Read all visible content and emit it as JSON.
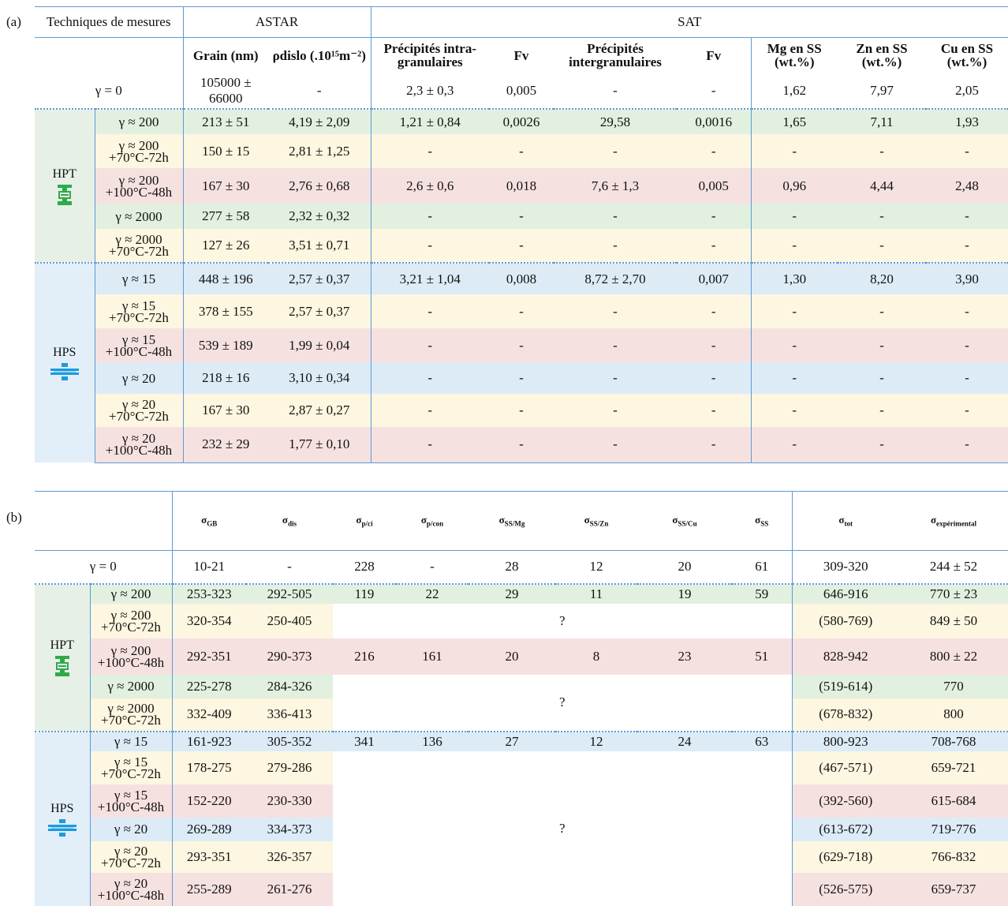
{
  "panel_a_label": "(a)",
  "panel_b_label": "(b)",
  "table_a": {
    "header_techniques": "Techniques de mesures",
    "header_astar": "ASTAR",
    "header_sat": "SAT",
    "col_grain": "Grain (nm)",
    "col_rho": "ρdislo (.10¹⁵m⁻²)",
    "col_prec_intra": "Précipités intra-granulaires",
    "col_fv1": "Fv",
    "col_prec_inter": "Précipités intergranulaires",
    "col_fv2": "Fv",
    "col_mg": "Mg en SS (wt.%)",
    "col_zn": "Zn en SS (wt.%)",
    "col_cu": "Cu en SS (wt.%)",
    "gamma0": {
      "label": "γ = 0",
      "cells": [
        "105000 ± 66000",
        "-",
        "2,3 ± 0,3",
        "0,005",
        "-",
        "-",
        "1,62",
        "7,97",
        "2,05"
      ]
    },
    "group_hpt": "HPT",
    "group_hps": "HPS",
    "hpt_rows": [
      {
        "l1": "γ ≈ 200",
        "l2": "",
        "cells": [
          "213 ± 51",
          "4,19 ± 2,09",
          "1,21 ± 0,84",
          "0,0026",
          "29,58",
          "0,0016",
          "1,65",
          "7,11",
          "1,93"
        ]
      },
      {
        "l1": "γ ≈ 200",
        "l2": "+70°C-72h",
        "cells": [
          "150 ± 15",
          "2,81 ± 1,25",
          "-",
          "-",
          "-",
          "-",
          "-",
          "-",
          "-"
        ]
      },
      {
        "l1": "γ ≈ 200",
        "l2": "+100°C-48h",
        "cells": [
          "167 ± 30",
          "2,76 ± 0,68",
          "2,6 ± 0,6",
          "0,018",
          "7,6 ± 1,3",
          "0,005",
          "0,96",
          "4,44",
          "2,48"
        ]
      },
      {
        "l1": "γ ≈ 2000",
        "l2": "",
        "cells": [
          "277 ± 58",
          "2,32 ± 0,32",
          "-",
          "-",
          "-",
          "-",
          "-",
          "-",
          "-"
        ]
      },
      {
        "l1": "γ ≈ 2000",
        "l2": "+70°C-72h",
        "cells": [
          "127 ± 26",
          "3,51 ± 0,71",
          "-",
          "-",
          "-",
          "-",
          "-",
          "-",
          "-"
        ]
      }
    ],
    "hps_rows": [
      {
        "l1": "γ ≈ 15",
        "l2": "",
        "cells": [
          "448 ± 196",
          "2,57 ± 0,37",
          "3,21 ± 1,04",
          "0,008",
          "8,72 ± 2,70",
          "0,007",
          "1,30",
          "8,20",
          "3,90"
        ]
      },
      {
        "l1": "γ ≈ 15",
        "l2": "+70°C-72h",
        "cells": [
          "378 ± 155",
          "2,57 ± 0,37",
          "-",
          "-",
          "-",
          "-",
          "-",
          "-",
          "-"
        ]
      },
      {
        "l1": "γ ≈ 15",
        "l2": "+100°C-48h",
        "cells": [
          "539 ± 189",
          "1,99 ± 0,04",
          "-",
          "-",
          "-",
          "-",
          "-",
          "-",
          "-"
        ]
      },
      {
        "l1": "γ ≈ 20",
        "l2": "",
        "cells": [
          "218 ± 16",
          "3,10 ± 0,34",
          "-",
          "-",
          "-",
          "-",
          "-",
          "-",
          "-"
        ]
      },
      {
        "l1": "γ ≈ 20",
        "l2": "+70°C-72h",
        "cells": [
          "167 ± 30",
          "2,87 ± 0,27",
          "-",
          "-",
          "-",
          "-",
          "-",
          "-",
          "-"
        ]
      },
      {
        "l1": "γ ≈ 20",
        "l2": "+100°C-48h",
        "cells": [
          "232 ± 29",
          "1,77 ± 0,10",
          "-",
          "-",
          "-",
          "-",
          "-",
          "-",
          "-"
        ]
      }
    ]
  },
  "table_b": {
    "headers": [
      "σGB",
      "σdis",
      "σp/ci",
      "σp/con",
      "σSS/Mg",
      "σSS/Zn",
      "σSS/Cu",
      "σSS",
      "σtot",
      "σexpérimental"
    ],
    "gamma0": {
      "label": "γ = 0",
      "cells": [
        "10-21",
        "-",
        "228",
        "-",
        "28",
        "12",
        "20",
        "61",
        "309-320",
        "244 ± 52"
      ]
    },
    "question_mark": "?",
    "group_hpt": "HPT",
    "group_hps": "HPS",
    "hpt_rows": [
      {
        "l1": "γ ≈ 200",
        "l2": "",
        "gb": "253-323",
        "dis": "292-505",
        "mid": [
          "119",
          "22",
          "29",
          "11",
          "19",
          "59"
        ],
        "tot": "646-916",
        "exp": "770 ± 23"
      },
      {
        "l1": "γ ≈ 200",
        "l2": "+70°C-72h",
        "gb": "320-354",
        "dis": "250-405",
        "mid": null,
        "tot": "(580-769)",
        "exp": "849 ± 50"
      },
      {
        "l1": "γ ≈ 200",
        "l2": "+100°C-48h",
        "gb": "292-351",
        "dis": "290-373",
        "mid": [
          "216",
          "161",
          "20",
          "8",
          "23",
          "51"
        ],
        "tot": "828-942",
        "exp": "800 ± 22"
      },
      {
        "l1": "γ ≈ 2000",
        "l2": "",
        "gb": "225-278",
        "dis": "284-326",
        "mid": null,
        "tot": "(519-614)",
        "exp": "770"
      },
      {
        "l1": "γ ≈ 2000",
        "l2": "+70°C-72h",
        "gb": "332-409",
        "dis": "336-413",
        "mid": null,
        "tot": "(678-832)",
        "exp": "800"
      }
    ],
    "hps_rows": [
      {
        "l1": "γ ≈ 15",
        "l2": "",
        "gb": "161-923",
        "dis": "305-352",
        "mid": [
          "341",
          "136",
          "27",
          "12",
          "24",
          "63"
        ],
        "tot": "800-923",
        "exp": "708-768"
      },
      {
        "l1": "γ ≈ 15",
        "l2": "+70°C-72h",
        "gb": "178-275",
        "dis": "279-286",
        "mid": null,
        "tot": "(467-571)",
        "exp": "659-721"
      },
      {
        "l1": "γ ≈ 15",
        "l2": "+100°C-48h",
        "gb": "152-220",
        "dis": "230-330",
        "mid": null,
        "tot": "(392-560)",
        "exp": "615-684"
      },
      {
        "l1": "γ ≈ 20",
        "l2": "",
        "gb": "269-289",
        "dis": "334-373",
        "mid": null,
        "tot": "(613-672)",
        "exp": "719-776"
      },
      {
        "l1": "γ ≈ 20",
        "l2": "+70°C-72h",
        "gb": "293-351",
        "dis": "326-357",
        "mid": null,
        "tot": "(629-718)",
        "exp": "766-832"
      },
      {
        "l1": "γ ≈ 20",
        "l2": "+100°C-48h",
        "gb": "255-289",
        "dis": "261-276",
        "mid": null,
        "tot": "(526-575)",
        "exp": "659-737"
      }
    ]
  },
  "row_colors": {
    "green": "#e2f0e0",
    "yellow": "#fdf6e0",
    "pink": "#f6e1e1",
    "blue": "#ddebf6"
  },
  "icons": {
    "hpt": "hpt-press-icon",
    "hps": "hps-press-icon"
  }
}
